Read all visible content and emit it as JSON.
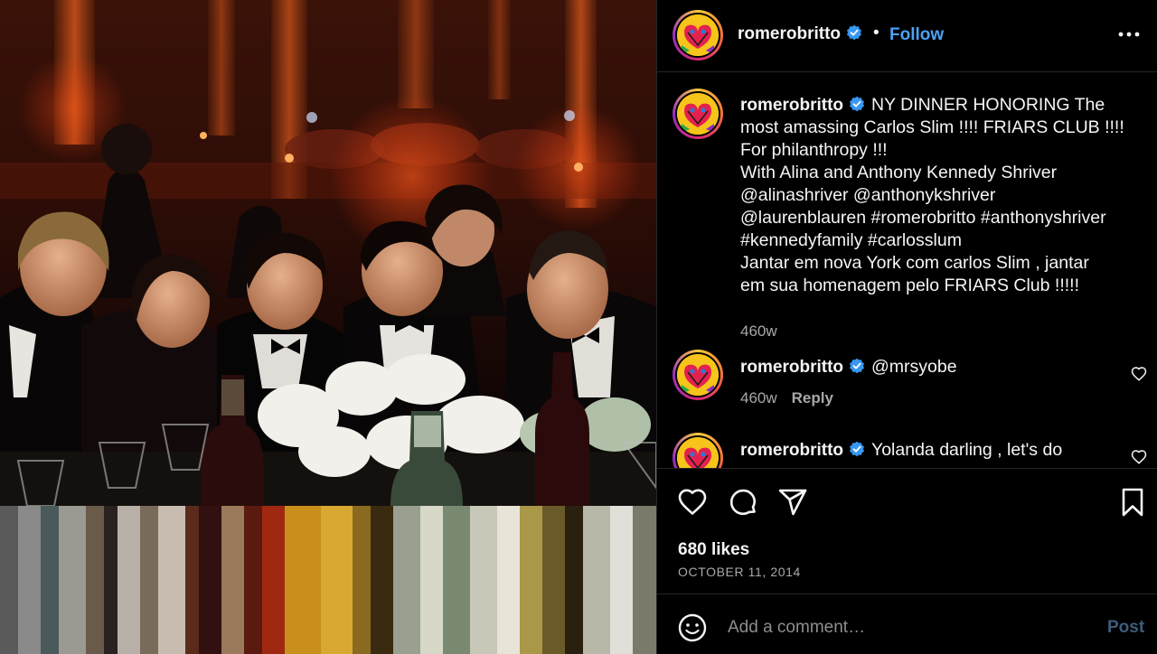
{
  "post": {
    "username": "romerobritto",
    "follow_label": "Follow",
    "separator": "•"
  },
  "caption": {
    "username": "romerobritto",
    "lines": [
      "NY DINNER HONORING The",
      "most amassing Carlos Slim !!!! FRIARS CLUB !!!!",
      "For philanthropy !!!",
      "With Alina and Anthony Kennedy Shriver",
      "@alinashriver @anthonykshriver",
      "@laurenblauren #romerobritto #anthonyshriver",
      "#kennedyfamily #carlosslum",
      "Jantar em nova York com carlos Slim , jantar",
      "em sua homenagem pelo FRIARS Club !!!!!"
    ],
    "time": "460w"
  },
  "comments": [
    {
      "username": "romerobritto",
      "text": "@mrsyobe",
      "time": "460w",
      "reply_label": "Reply"
    },
    {
      "username": "romerobritto",
      "text": "Yolanda darling , let's do"
    }
  ],
  "engagement": {
    "likes": "680 likes",
    "date": "OCTOBER 11, 2014"
  },
  "composer": {
    "placeholder": "Add a comment…",
    "post_label": "Post"
  },
  "icons": {
    "more": "more-options-icon",
    "verified": "verified-badge-icon",
    "like": "heart-icon",
    "comment": "comment-icon",
    "share": "share-icon",
    "save": "bookmark-icon",
    "emoji": "emoji-icon"
  },
  "colors": {
    "background": "#000000",
    "link_blue": "#4aa3f6",
    "verified_blue": "#3897f0",
    "muted_text": "#a8a8a8",
    "post_disabled": "#3b5d7c"
  }
}
